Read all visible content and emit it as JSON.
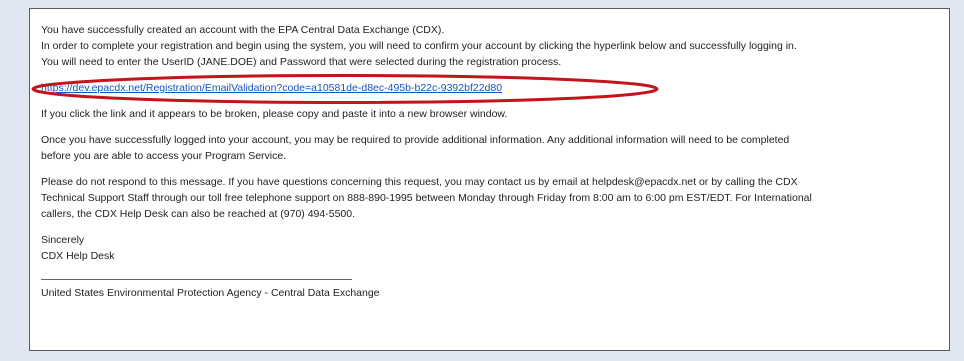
{
  "email": {
    "intro": [
      "You have successfully created an account with the EPA Central Data Exchange (CDX).",
      "In order to complete your registration and begin using the system, you will need to confirm your account by clicking the hyperlink below and successfully logging in.",
      "You will need to enter the UserID (JANE.DOE) and Password that were selected during the registration process."
    ],
    "link": "https://dev.epacdx.net/Registration/EmailValidation?code=a10581de-d8ec-495b-b22c-9392bf22d80",
    "broken_link_note": "If you click the link and it appears to be broken, please copy and paste it into a new browser window.",
    "additional_info": [
      "Once you have successfully logged into your account, you may be required to provide additional information. Any additional information will need to be completed",
      "before you are able to access your Program Service."
    ],
    "contact": [
      "Please do not respond to this message. If you have questions concerning this request, you may contact us by email at helpdesk@epacdx.net or by calling the CDX",
      "Technical Support Staff through our toll free telephone support on 888-890-1995 between Monday through Friday from 8:00 am to 6:00 pm EST/EDT. For International",
      "callers, the CDX Help Desk can also be reached at (970) 494-5500."
    ],
    "signoff": "Sincerely",
    "signature": "CDX Help Desk",
    "footer": "United States Environmental Protection Agency - Central Data Exchange"
  },
  "colors": {
    "background": "#dfe8f2",
    "link": "#1155cc",
    "highlight": "#c4141c",
    "text": "#1f1f1f"
  }
}
